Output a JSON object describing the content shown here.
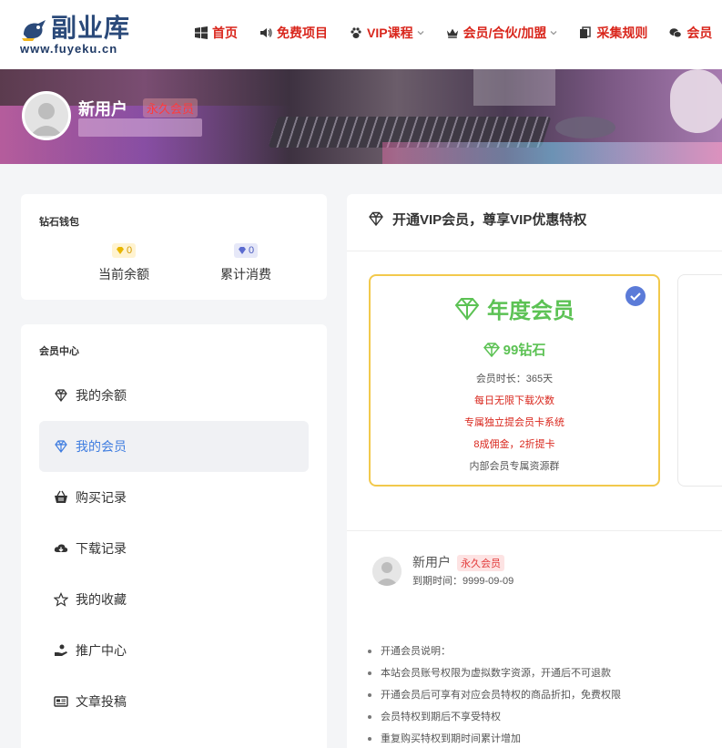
{
  "header": {
    "logo_text": "副业库",
    "logo_url": "www.fuyeku.cn",
    "nav": [
      {
        "label": "首页",
        "icon": "windows-icon"
      },
      {
        "label": "免费项目",
        "icon": "speaker-icon"
      },
      {
        "label": "VIP课程",
        "icon": "paw-icon",
        "dropdown": true
      },
      {
        "label": "会员/合伙/加盟",
        "icon": "crown-icon",
        "dropdown": true
      },
      {
        "label": "采集规则",
        "icon": "copy-icon"
      },
      {
        "label": "会员",
        "icon": "wechat-icon"
      }
    ]
  },
  "profile": {
    "username": "新用户",
    "badge": "永久会员"
  },
  "wallet": {
    "title": "钻石钱包",
    "balance_value": "0",
    "balance_label": "当前余额",
    "spent_value": "0",
    "spent_label": "累计消费"
  },
  "member_center": {
    "title": "会员中心",
    "items": [
      {
        "label": "我的余额",
        "icon": "diamond-icon"
      },
      {
        "label": "我的会员",
        "icon": "diamond-icon",
        "active": true
      },
      {
        "label": "购买记录",
        "icon": "basket-icon"
      },
      {
        "label": "下载记录",
        "icon": "cloud-download-icon"
      },
      {
        "label": "我的收藏",
        "icon": "star-icon"
      },
      {
        "label": "推广中心",
        "icon": "hand-coin-icon"
      },
      {
        "label": "文章投稿",
        "icon": "newspaper-icon"
      }
    ]
  },
  "vip": {
    "heading": "开通VIP会员，尊享VIP优惠特权",
    "plan": {
      "name": "年度会员",
      "price": "99钻石",
      "duration": "会员时长：365天",
      "perk1": "每日无限下载次数",
      "perk2": "专属独立提会员卡系统",
      "perk3": "8成佣金，2折提卡",
      "perk4": "内部会员专属资源群"
    },
    "user": {
      "name": "新用户",
      "badge": "永久会员",
      "expire": "到期时间：9999-09-09"
    },
    "notes": [
      "开通会员说明：",
      "本站会员账号权限为虚拟数字资源，开通后不可退款",
      "开通会员后可享有对应会员特权的商品折扣，免费权限",
      "会员特权到期后不享受特权",
      "重复购买特权到期时间累计增加"
    ]
  },
  "colors": {
    "accent_red": "#d9261c",
    "accent_green": "#5cc254",
    "accent_gold": "#f2c94c",
    "active_blue": "#3f7de0"
  }
}
